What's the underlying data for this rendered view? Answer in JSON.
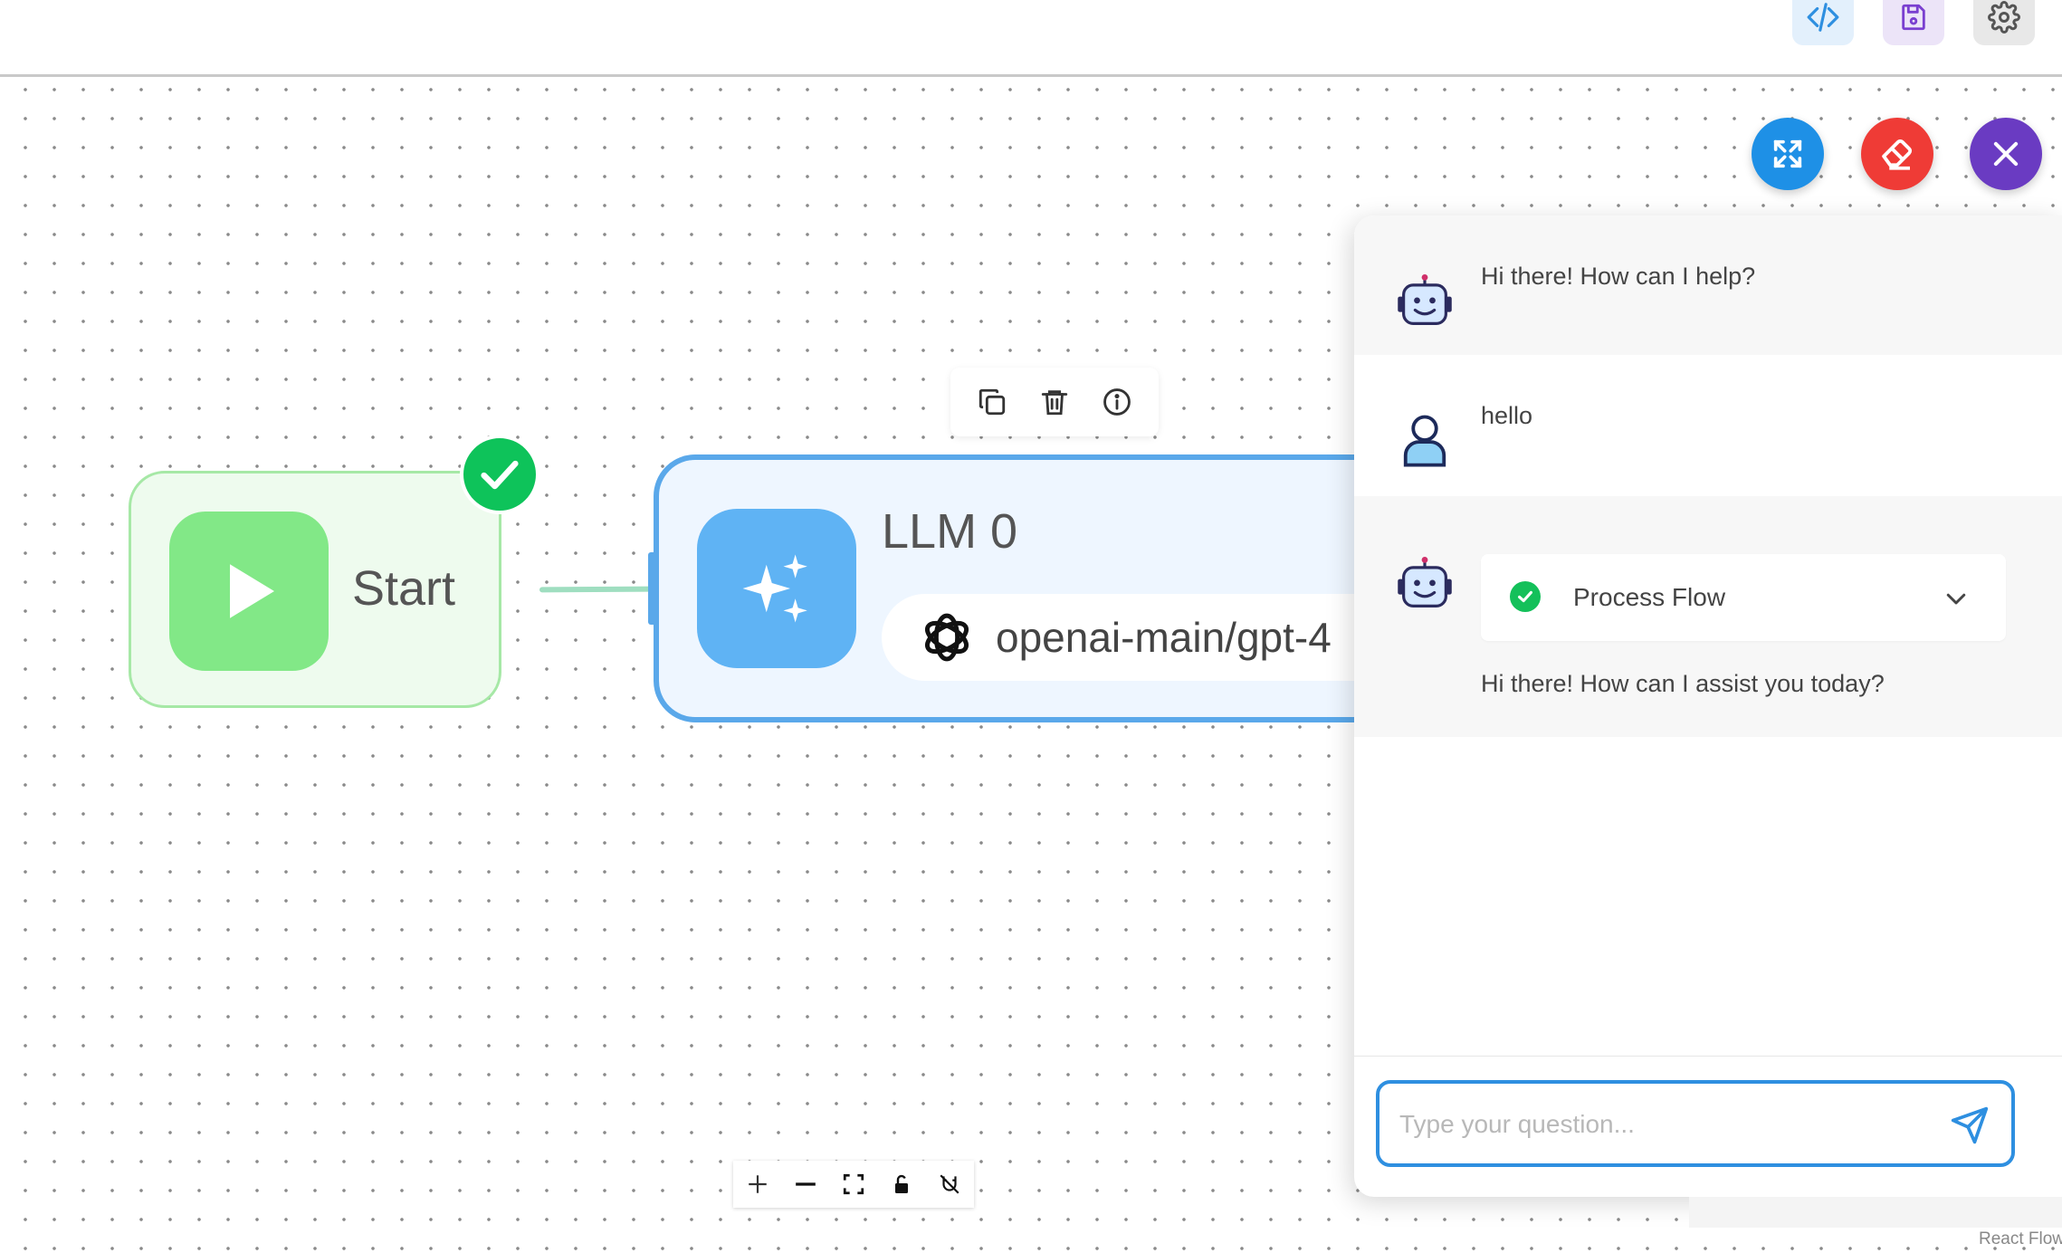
{
  "toolbar": {
    "code_icon": "code-icon",
    "save_icon": "save-icon",
    "settings_icon": "gear-icon"
  },
  "fabs": {
    "expand_icon": "expand-icon",
    "erase_icon": "eraser-icon",
    "close_icon": "close-icon",
    "colors": {
      "expand": "#1e90e6",
      "erase": "#ef3b36",
      "close": "#6a3bc2"
    }
  },
  "nodes": {
    "start": {
      "label": "Start",
      "status": "success"
    },
    "llm": {
      "title": "LLM 0",
      "model": "openai-main/gpt-4"
    }
  },
  "node_toolbar": [
    "copy-icon",
    "trash-icon",
    "info-icon"
  ],
  "chat": {
    "messages": [
      {
        "role": "bot",
        "text": "Hi there! How can I help?"
      },
      {
        "role": "user",
        "text": "hello"
      },
      {
        "role": "bot",
        "process_label": "Process Flow",
        "text": "Hi there! How can I assist you today?"
      }
    ],
    "input": {
      "value": "",
      "placeholder": "Type your question..."
    }
  },
  "attribution": "React Flow"
}
